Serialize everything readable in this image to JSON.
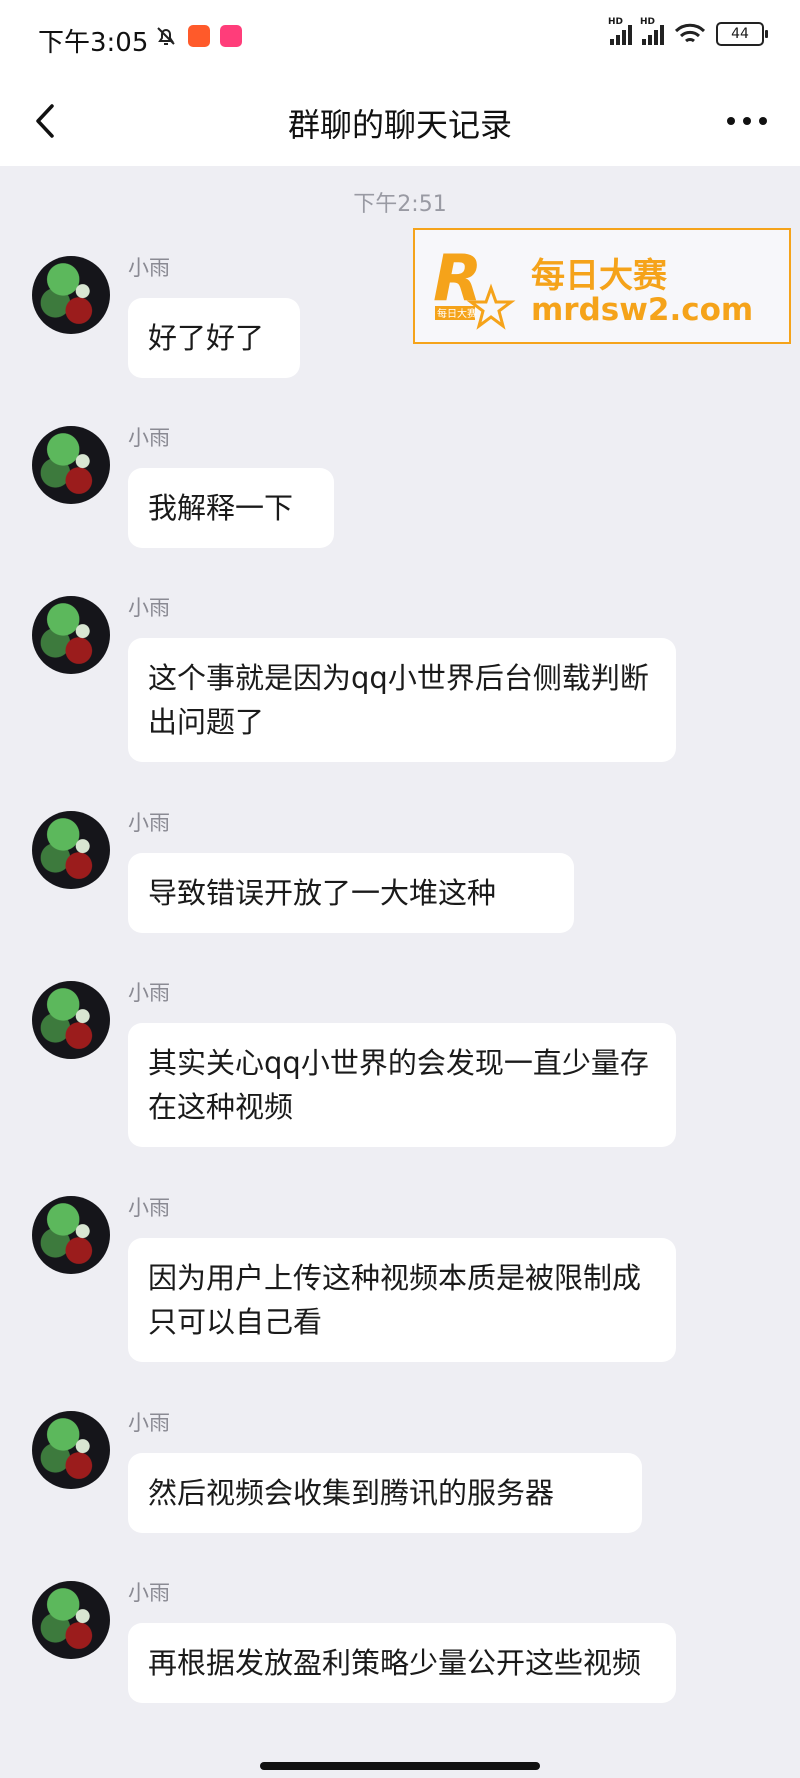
{
  "status": {
    "time": "下午3:05",
    "battery": "44",
    "hd": "HD"
  },
  "header": {
    "title": "群聊的聊天记录"
  },
  "timestamp": "下午2:51",
  "watermark": {
    "cn": "每日大赛",
    "url": "mrdsw2.com",
    "logo_letter": "R",
    "logo_sub": "每日大赛"
  },
  "messages": [
    {
      "sender": "小雨",
      "text": "好了好了"
    },
    {
      "sender": "小雨",
      "text": "我解释一下"
    },
    {
      "sender": "小雨",
      "text": "这个事就是因为qq小世界后台侧载判断出问题了"
    },
    {
      "sender": "小雨",
      "text": "导致错误开放了一大堆这种"
    },
    {
      "sender": "小雨",
      "text": "其实关心qq小世界的会发现一直少量存在这种视频"
    },
    {
      "sender": "小雨",
      "text": "因为用户上传这种视频本质是被限制成只可以自己看"
    },
    {
      "sender": "小雨",
      "text": "然后视频会收集到腾讯的服务器"
    },
    {
      "sender": "小雨",
      "text": "再根据发放盈利策略少量公开这些视频"
    }
  ]
}
